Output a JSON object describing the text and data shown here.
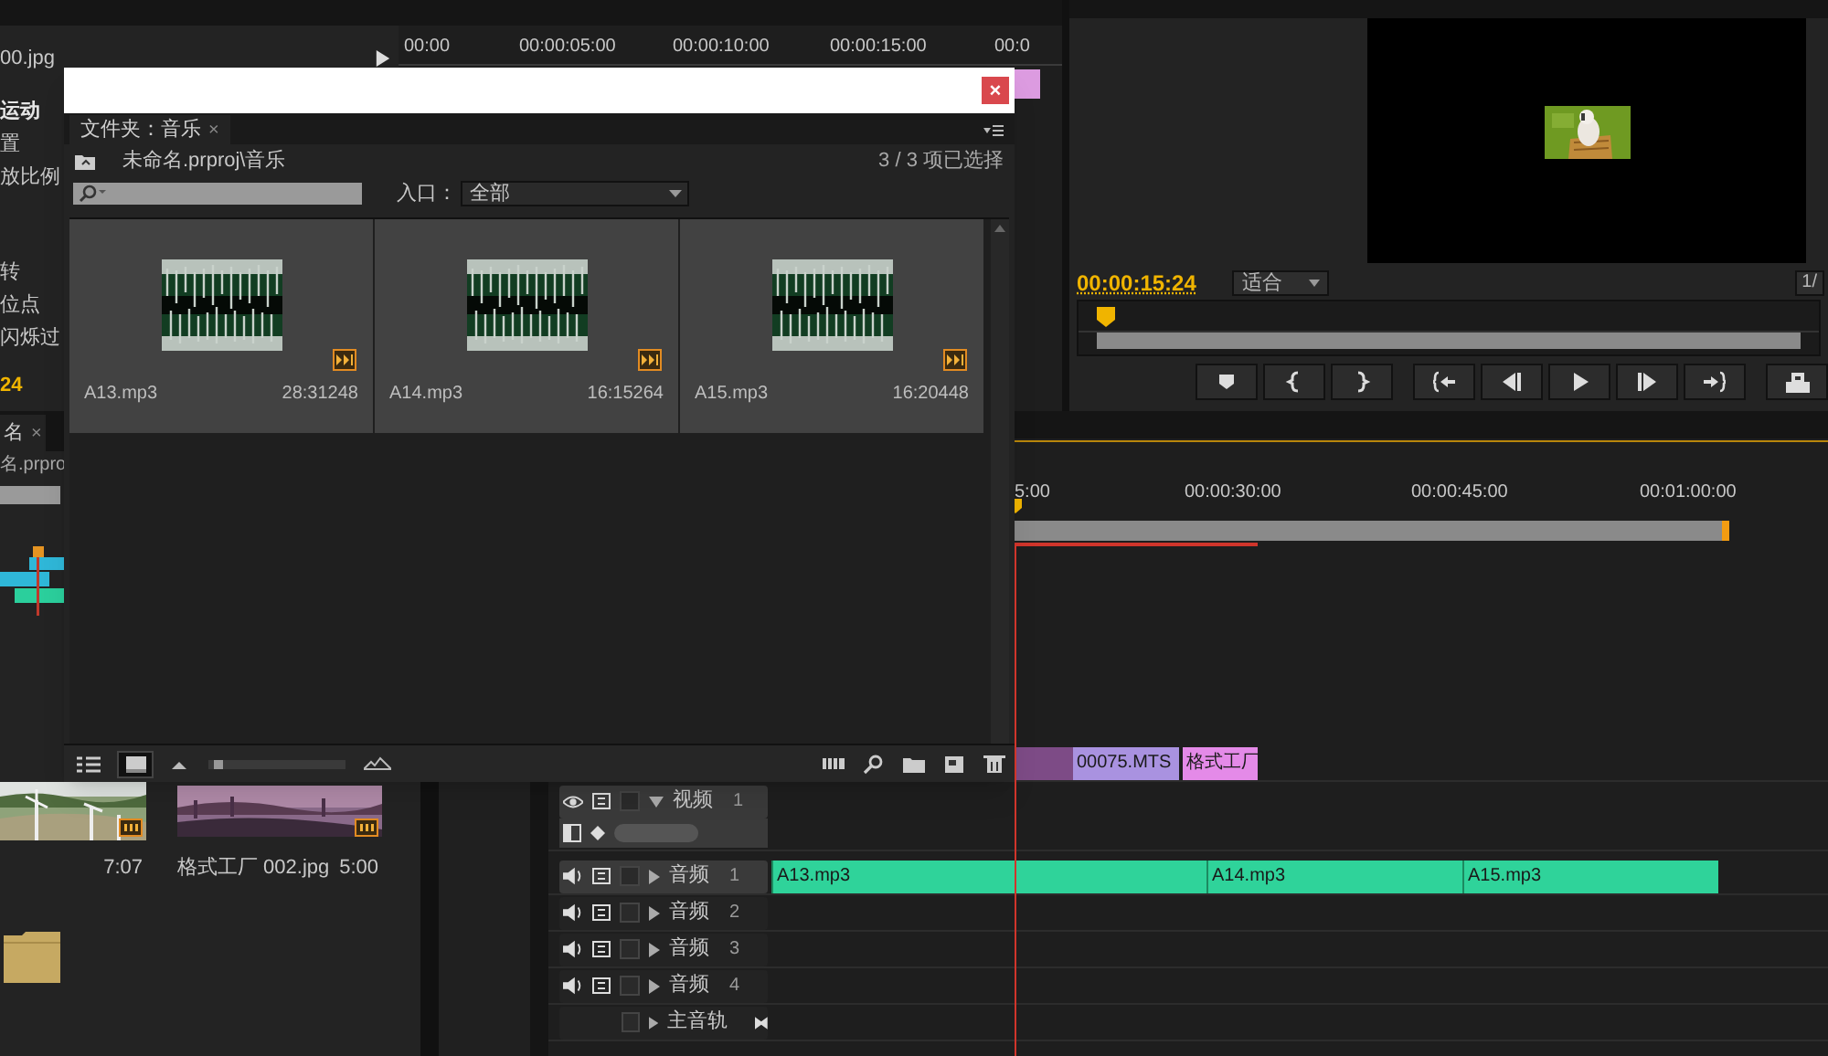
{
  "effect_controls": {
    "clip": "00.jpg",
    "ruler": [
      "00:00",
      "00:00:05:00",
      "00:00:10:00",
      "00:00:15:00",
      "00:0"
    ],
    "properties": [
      {
        "label": "运动",
        "kind": "group"
      },
      {
        "label": "置",
        "kind": "property"
      },
      {
        "label": "放比例",
        "kind": "property"
      },
      {
        "label": "转",
        "kind": "property"
      },
      {
        "label": "位点",
        "kind": "property"
      },
      {
        "label": "闪烁过",
        "kind": "property"
      }
    ],
    "timecode": "24"
  },
  "program_monitor": {
    "timecode": "00:00:15:24",
    "zoom": "适合",
    "resolution": "1/"
  },
  "project": {
    "tab": "名",
    "tab_close": "×",
    "path": "名.prpro",
    "items": [
      {
        "kind": "windmills",
        "duration": "7:07"
      },
      {
        "kind": "dusk",
        "name": "格式工厂 002.jpg",
        "duration": "5:00"
      }
    ]
  },
  "timeline": {
    "ruler": [
      "5:00",
      "00:00:30:00",
      "00:00:45:00",
      "00:01:00:00"
    ],
    "video_clips": [
      {
        "color": "#7d4b86"
      },
      {
        "name": "00075.MTS",
        "color": "#a992e0"
      },
      {
        "name": "格式工厂",
        "color": "#e48ae8"
      }
    ],
    "tracks": [
      {
        "kind": "video",
        "name": "视频",
        "number": "1",
        "selected": true
      },
      {
        "kind": "audio",
        "name": "音频",
        "number": "1",
        "selected": true,
        "clips": [
          "A13.mp3",
          "A14.mp3",
          "A15.mp3"
        ]
      },
      {
        "kind": "audio",
        "name": "音频",
        "number": "2",
        "selected": false
      },
      {
        "kind": "audio",
        "name": "音频",
        "number": "3",
        "selected": false
      },
      {
        "kind": "audio",
        "name": "音频",
        "number": "4",
        "selected": false
      },
      {
        "kind": "master",
        "name": "主音轨",
        "selected": false
      }
    ]
  },
  "dialog": {
    "close": "×",
    "tab": "文件夹：音乐",
    "tab_close": "×",
    "path": "未命名.prproj\\音乐",
    "selection": "3 / 3 项已选择",
    "filter_label": "入口：",
    "filter_value": "全部",
    "items": [
      {
        "name": "A13.mp3",
        "duration": "28:31248",
        "selected": true
      },
      {
        "name": "A14.mp3",
        "duration": "16:15264",
        "selected": true
      },
      {
        "name": "A15.mp3",
        "duration": "16:20448",
        "selected": true
      }
    ],
    "size_slider": {
      "level": 0.04
    },
    "view_modes": [
      {
        "kind": "list",
        "selected": false
      },
      {
        "kind": "icon",
        "selected": true
      }
    ]
  }
}
